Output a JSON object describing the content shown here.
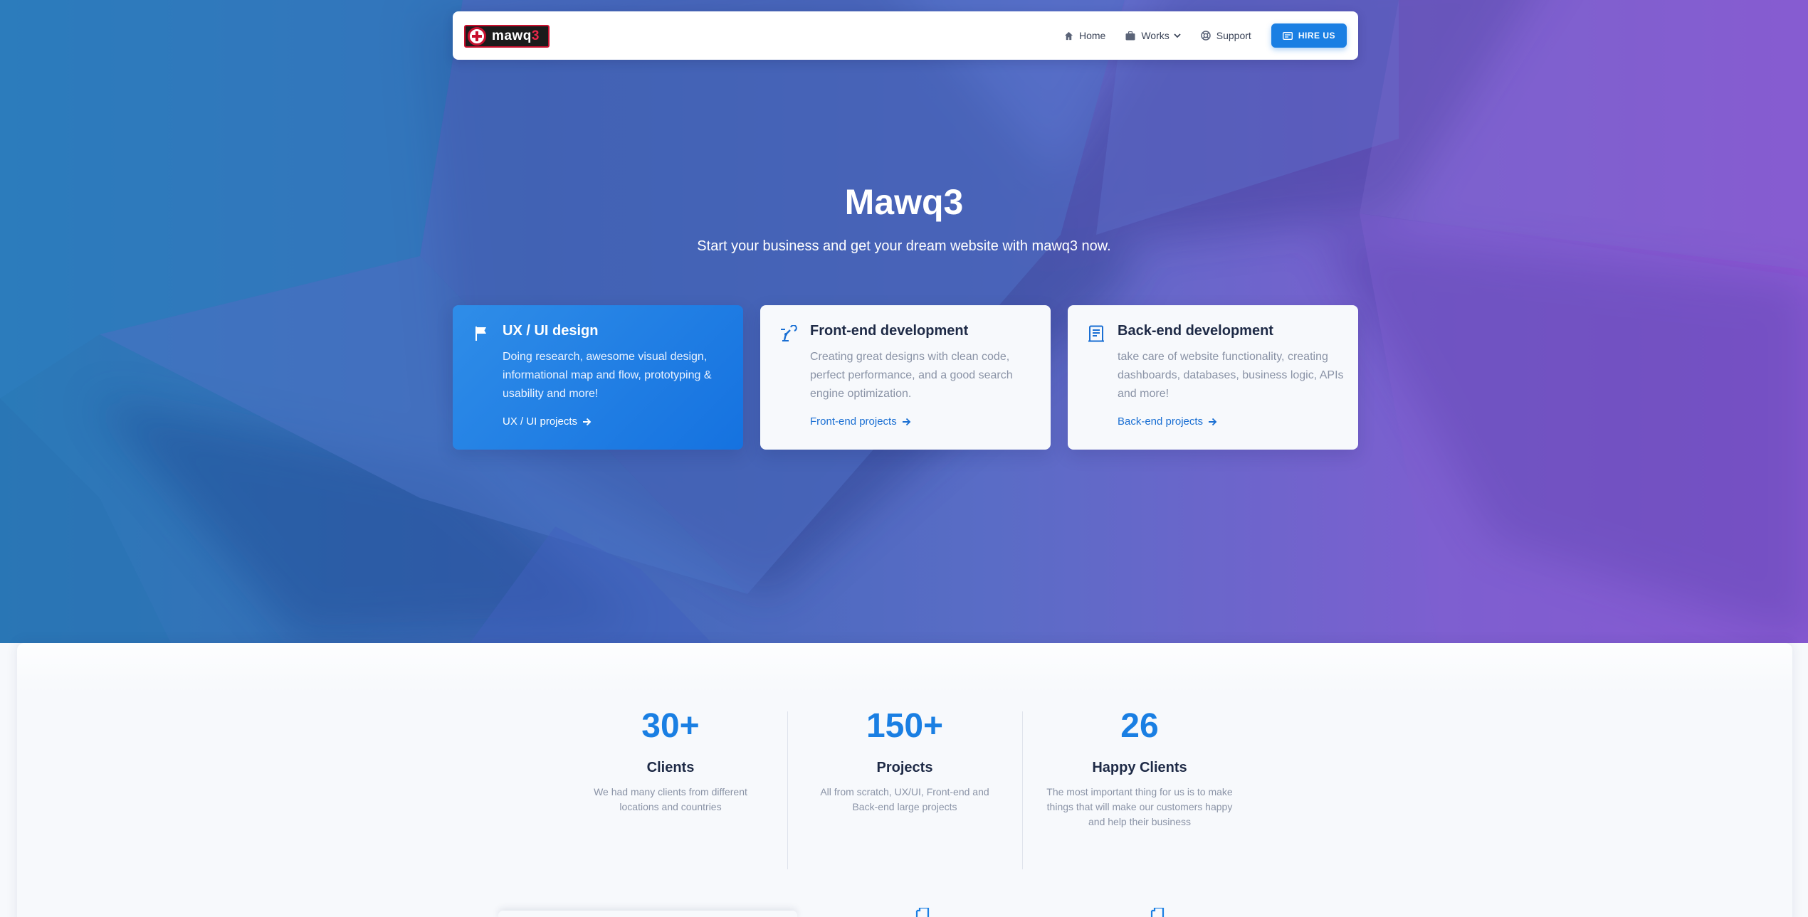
{
  "colors": {
    "accent": "#1a7fe3",
    "brand_red": "#c8102e",
    "hero_left": "#2a7ab8",
    "hero_right": "#8d56d4"
  },
  "navbar": {
    "logo_text": "mawq",
    "logo_accent": "3",
    "items": [
      {
        "label": "Home",
        "icon": "home-icon"
      },
      {
        "label": "Works",
        "icon": "briefcase-icon",
        "has_dropdown": true
      },
      {
        "label": "Support",
        "icon": "lifebuoy-icon"
      }
    ],
    "cta_label": "HIRE US",
    "cta_icon": "id-card-icon"
  },
  "hero": {
    "title": "Mawq3",
    "subtitle": "Start your business and get your dream website with mawq3 now."
  },
  "services": [
    {
      "title": "UX / UI design",
      "description": "Doing research, awesome visual design, informational map and flow, prototyping & usability and more!",
      "link": "UX / UI projects",
      "icon": "flag-icon"
    },
    {
      "title": "Front-end development",
      "description": "Creating great designs with clean code, perfect performance, and a good search engine optimization.",
      "link": "Front-end projects",
      "icon": "robot-arm-icon"
    },
    {
      "title": "Back-end development",
      "description": "take care of website functionality, creating dashboards, databases, business logic, APIs and more!",
      "link": "Back-end projects",
      "icon": "document-icon"
    }
  ],
  "stats": [
    {
      "number": "30+",
      "title": "Clients",
      "description": "We had many clients from different locations and countries"
    },
    {
      "number": "150+",
      "title": "Projects",
      "description": "All from scratch, UX/UI, Front-end and Back-end large projects"
    },
    {
      "number": "26",
      "title": "Happy Clients",
      "description": "The most important thing for us is to make things that will make our customers happy and help their business"
    }
  ]
}
